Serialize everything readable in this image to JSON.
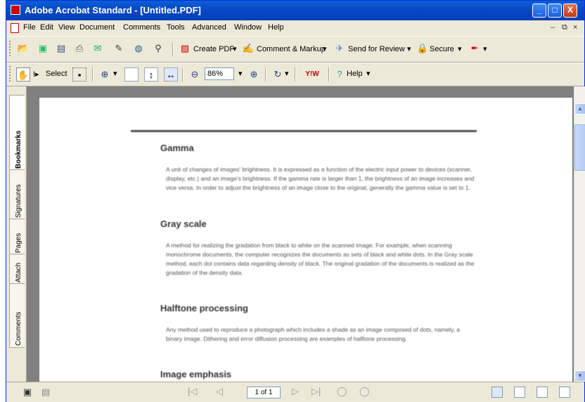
{
  "window": {
    "title": "Adobe Acrobat Standard - [Untitled.PDF]",
    "minimize": "_",
    "maximize": "□",
    "close": "X"
  },
  "menu": [
    "File",
    "Edit",
    "View",
    "Document",
    "Comments",
    "Tools",
    "Advanced",
    "Window",
    "Help"
  ],
  "mdi": {
    "min": "–",
    "restore": "⧉",
    "close": "×"
  },
  "toolbar1": {
    "create_pdf": "Create PDF",
    "comment_markup": "Comment & Markup",
    "send_review": "Send for Review",
    "secure": "Secure"
  },
  "toolbar2": {
    "select": "Select",
    "zoom": "86%",
    "help": "Help"
  },
  "nav_tabs": [
    "Bookmarks",
    "Signatures",
    "Pages",
    "Attach",
    "Comments"
  ],
  "document": {
    "sections": [
      {
        "heading": "Gamma",
        "text": "A unit of changes of images' brightness. It is expressed as a function of the electric input power to devices (scanner, display, etc.) and an image's brightness. If the gamma rate is larger than 1, the brightness of an image increases and vice versa. In order to adjust the brightness of an image close to the original, generally the gamma value is set to 1."
      },
      {
        "heading": "Gray scale",
        "text": "A method for realizing the gradation from black to white on the scanned image. For example, when scanning monochrome documents, the computer recognizes the documents as sets of black and white dots. In the Gray scale method, each dot contains data regarding density of black. The original gradation of the documents is realized as the gradation of the density data."
      },
      {
        "heading": "Halftone processing",
        "text": "Any method used to reproduce a photograph which includes a shade as an image composed of dots, namely, a binary image. Dithering and error diffusion processing are examples of halftone processing."
      },
      {
        "heading": "Image emphasis",
        "text": ""
      }
    ]
  },
  "status": {
    "page": "1 of 1"
  },
  "colors": {
    "titlebar": "#0A5FD8",
    "chrome": "#ECE9D8",
    "docbg": "#808080"
  }
}
